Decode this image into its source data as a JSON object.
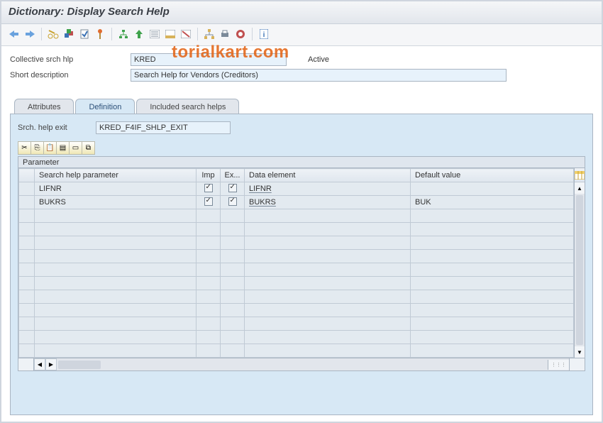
{
  "title": "Dictionary: Display Search Help",
  "watermark": "torialkart.com",
  "toolbar": {
    "hint_back": "Back",
    "hint_forward": "Forward",
    "hint_display": "Display/Change",
    "hint_other": "Other Object",
    "hint_check": "Check",
    "hint_activate": "Activate",
    "hint_where": "Where-Used List"
  },
  "form": {
    "collective_label": "Collective srch hlp",
    "collective_value": "KRED",
    "status": "Active",
    "short_desc_label": "Short description",
    "short_desc_value": "Search Help for Vendors (Creditors)"
  },
  "tabs": {
    "attributes": "Attributes",
    "definition": "Definition",
    "included": "Included search helps"
  },
  "definition": {
    "exit_label": "Srch. help exit",
    "exit_value": "KRED_F4IF_SHLP_EXIT",
    "mini_tb": {
      "cut": "Cut",
      "copy": "Copy",
      "paste": "Paste",
      "insert": "Insert",
      "delete": "Delete",
      "dup": "Duplicate"
    },
    "table_title": "Parameter",
    "columns": {
      "param": "Search help parameter",
      "imp": "Imp",
      "exp": "Ex...",
      "elem": "Data element",
      "def": "Default value"
    },
    "rows": [
      {
        "param": "LIFNR",
        "imp": true,
        "exp": true,
        "elem": "LIFNR",
        "def": ""
      },
      {
        "param": "BUKRS",
        "imp": true,
        "exp": true,
        "elem": "BUKRS",
        "def": "BUK"
      }
    ],
    "empty_rows": 11
  },
  "icons": {
    "scissors": "✂",
    "copy": "⎘",
    "paste": "📋",
    "rowins": "▤",
    "rowdel": "▭",
    "dup": "⧉",
    "config": "▦"
  }
}
